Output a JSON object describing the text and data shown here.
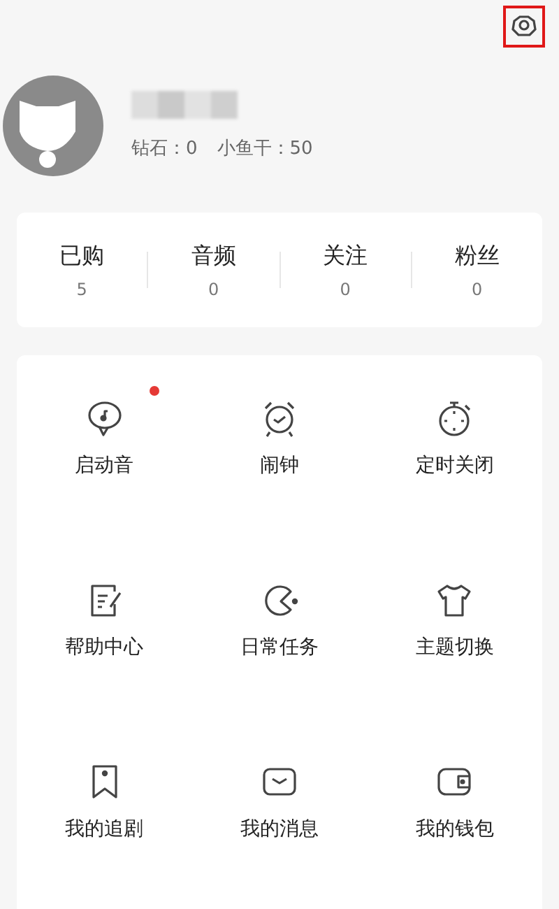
{
  "profile": {
    "name_hidden": true,
    "diamonds_label": "钻石：0",
    "fish_label": "小鱼干：50"
  },
  "settings": {
    "highlighted": true
  },
  "stats": [
    {
      "label": "已购",
      "value": "5"
    },
    {
      "label": "音频",
      "value": "0"
    },
    {
      "label": "关注",
      "value": "0"
    },
    {
      "label": "粉丝",
      "value": "0"
    }
  ],
  "menu": [
    {
      "label": "启动音",
      "kind": "chatmusic",
      "badge": true
    },
    {
      "label": "闹钟",
      "kind": "alarm",
      "badge": false
    },
    {
      "label": "定时关闭",
      "kind": "timer",
      "badge": false
    },
    {
      "label": "帮助中心",
      "kind": "note",
      "badge": false
    },
    {
      "label": "日常任务",
      "kind": "pacman",
      "badge": false
    },
    {
      "label": "主题切换",
      "kind": "shirt",
      "badge": false
    },
    {
      "label": "我的追剧",
      "kind": "bookmark",
      "badge": false
    },
    {
      "label": "我的消息",
      "kind": "mail",
      "badge": false
    },
    {
      "label": "我的钱包",
      "kind": "wallet",
      "badge": false
    }
  ]
}
